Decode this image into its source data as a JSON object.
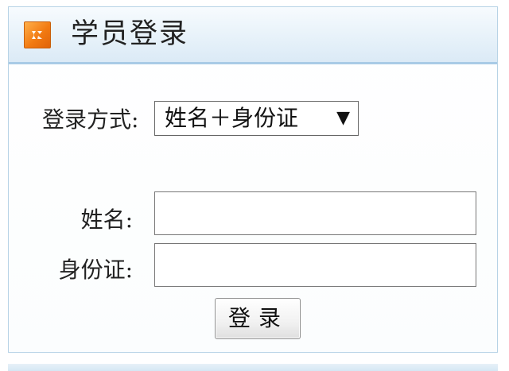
{
  "header": {
    "title": "学员登录",
    "icon": "orange-logo-icon",
    "accent_color": "#f27a12",
    "header_band_color": "#dbeaf6"
  },
  "login_method": {
    "label": "登录方式:",
    "selected": "姓名＋身份证",
    "arrow": "▼"
  },
  "fields": {
    "name_label": "姓名:",
    "name_value": "",
    "id_label": "身份证:",
    "id_value": ""
  },
  "submit": {
    "label": "登录"
  }
}
